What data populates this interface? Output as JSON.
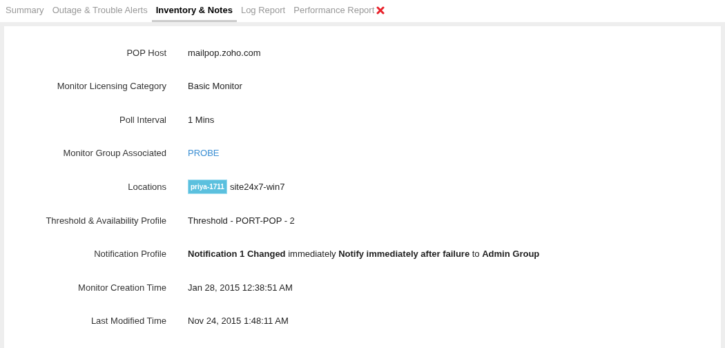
{
  "tabs": [
    {
      "label": "Summary",
      "selected": false,
      "alert": false
    },
    {
      "label": "Outage & Trouble Alerts",
      "selected": false,
      "alert": false
    },
    {
      "label": "Inventory & Notes",
      "selected": true,
      "alert": false
    },
    {
      "label": "Log Report",
      "selected": false,
      "alert": false
    },
    {
      "label": "Performance Report",
      "selected": false,
      "alert": true
    }
  ],
  "fields": [
    {
      "label": "POP Host",
      "kind": "text",
      "value": "mailpop.zoho.com"
    },
    {
      "label": "Monitor Licensing Category",
      "kind": "text",
      "value": "Basic Monitor"
    },
    {
      "label": "Poll Interval",
      "kind": "text",
      "value": "1 Mins"
    },
    {
      "label": "Monitor Group Associated",
      "kind": "link",
      "value": "PROBE"
    },
    {
      "label": "Locations",
      "kind": "location",
      "tag": "priya-1711",
      "value": "site24x7-win7"
    },
    {
      "label": "Threshold & Availability Profile",
      "kind": "text",
      "value": "Threshold - PORT-POP - 2"
    },
    {
      "label": "Notification Profile",
      "kind": "text",
      "value": "**Notification 1 Changed** immediately **Notify immediately after failure** to **Admin Group**"
    },
    {
      "label": "Monitor Creation Time",
      "kind": "text",
      "value": "Jan 28, 2015 12:38:51 AM"
    },
    {
      "label": "Last Modified Time",
      "kind": "text",
      "value": "Nov 24, 2015 1:48:11 AM"
    }
  ]
}
